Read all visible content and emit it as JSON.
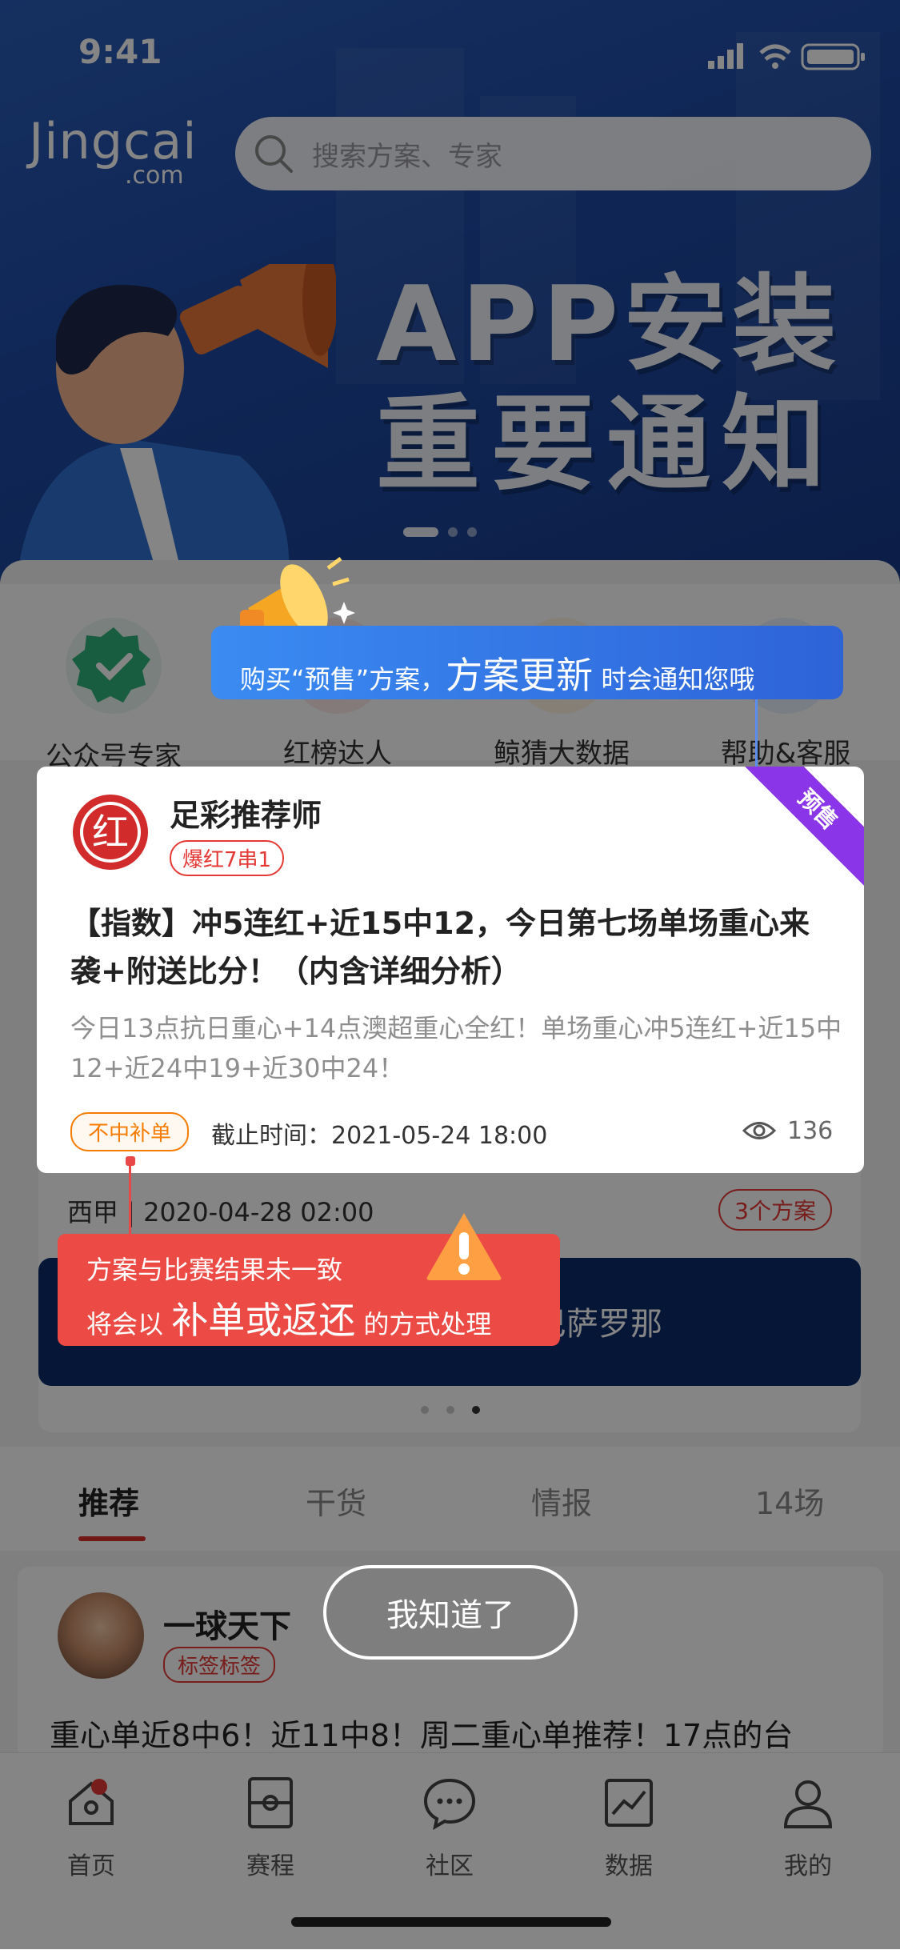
{
  "status": {
    "time": "9:41"
  },
  "logo": {
    "main": "Jingcai",
    "sub": ".com"
  },
  "search": {
    "placeholder": "搜索方案、专家"
  },
  "banner": {
    "line1": "APP安装",
    "line2": "重要通知",
    "active_dot": 1,
    "dot_count": 3
  },
  "quick_links": [
    {
      "label": "公众号专家",
      "icon": "verified-badge-icon"
    },
    {
      "label": "红榜达人",
      "icon": "red-list-icon"
    },
    {
      "label": "鲸猜大数据",
      "icon": "big-data-icon"
    },
    {
      "label": "帮助&客服",
      "icon": "help-icon"
    }
  ],
  "tip_top": {
    "prefix": "购买“预售”方案，",
    "highlight": "方案更新",
    "suffix": " 时会通知您哦"
  },
  "card": {
    "expert_name": "足彩推荐师",
    "logo_char": "红",
    "badge": "爆红7串1",
    "ribbon": "预售",
    "title": "【指数】冲5连红+近15中12，今日第七场单场重心来袭+附送比分！（内含详细分析）",
    "desc": "今日13点抗日重心+14点澳超重心全红！单场重心冲5连红+近15中12+近24中19+近30中24！",
    "tag": "不中补单",
    "deadline": "截止时间：2021-05-24 18:00",
    "views": "136"
  },
  "match": {
    "league": "西甲 | 2020-04-28 02:00",
    "count": "3个方案",
    "team_right": "巴萨罗那"
  },
  "tip_bottom": {
    "line1": "方案与比赛结果未一致",
    "line2_prefix": "将会以 ",
    "line2_highlight": "补单或返还",
    "line2_suffix": " 的方式处理"
  },
  "tabs": [
    {
      "label": "推荐",
      "active": true
    },
    {
      "label": "干货"
    },
    {
      "label": "情报"
    },
    {
      "label": "14场"
    }
  ],
  "post": {
    "author": "一球天下",
    "tag": "标签标签",
    "text": "重心单近8中6！近11中8！周二重心单推荐！17点的台"
  },
  "button": {
    "label": "我知道了"
  },
  "tabbar": [
    {
      "label": "首页",
      "icon": "home-icon"
    },
    {
      "label": "赛程",
      "icon": "schedule-icon"
    },
    {
      "label": "社区",
      "icon": "community-icon"
    },
    {
      "label": "数据",
      "icon": "data-icon"
    },
    {
      "label": "我的",
      "icon": "profile-icon"
    }
  ],
  "colors": {
    "accent_red": "#e53935",
    "tip_blue": "#3a8bf2",
    "tip_red": "#ec4a44",
    "ribbon_purple": "#8a36e8",
    "banner_blue": "#1e4aa4"
  }
}
